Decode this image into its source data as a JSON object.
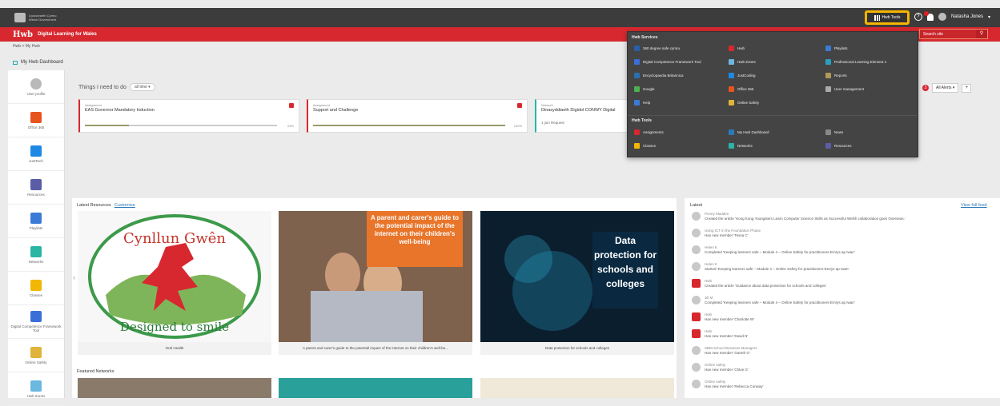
{
  "topbar": {
    "gov_logo_text": "Llywodraeth Cymru Welsh Government",
    "tools_label": "Hwb Tools",
    "help_label": "?",
    "user_name": "Natasha Jones"
  },
  "header": {
    "brand": "Hwb",
    "subtitle": "Digital Learning for Wales",
    "search_placeholder": "Search site",
    "accent": "#d7282f"
  },
  "breadcrumb": "Hwb > My Hwb",
  "dashboard_link": "My Hwb Dashboard",
  "sidebar": {
    "items": [
      {
        "label": "User profile",
        "icon": "user-icon",
        "color": "#b9b9b9"
      },
      {
        "label": "Office 365",
        "icon": "office-icon",
        "color": "#e8541e"
      },
      {
        "label": "JustTech",
        "icon": "just2easy-icon",
        "color": "#1e88e5"
      },
      {
        "label": "Resources",
        "icon": "resources-icon",
        "color": "#5b5ea6"
      },
      {
        "label": "Playlists",
        "icon": "playlists-icon",
        "color": "#3a7bd5"
      },
      {
        "label": "Networks",
        "icon": "networks-icon",
        "color": "#2ab5a5"
      },
      {
        "label": "Classes",
        "icon": "classes-icon",
        "color": "#f2b705"
      },
      {
        "label": "Digital Competence Framework Tool",
        "icon": "dcf-icon",
        "color": "#3a6fd8"
      },
      {
        "label": "Online Safety",
        "icon": "online-safety-icon",
        "color": "#e0b43a"
      },
      {
        "label": "Hwb Zones",
        "icon": "hwb-zones-icon",
        "color": "#6bb8e0"
      }
    ]
  },
  "todo": {
    "title": "Things I need to do",
    "filter": "all time",
    "cards": [
      {
        "type": "Assignment",
        "title": "EAS Governor Mandatory Induction",
        "pct_label": "23%",
        "progress": 0.23
      },
      {
        "type": "Assignment",
        "title": "Support and Challenge",
        "pct_label": "100%",
        "progress": 1.0
      },
      {
        "type": "Network",
        "title": "Dinasyddiaeth Digidol CONWY Digital",
        "sub": "1 join Request"
      }
    ]
  },
  "alerts": {
    "count": "3",
    "label": "All Alerts",
    "plus": "+"
  },
  "latest_resources": {
    "title": "Latest Resources",
    "customise": "Customise",
    "cards": [
      {
        "caption": "Oral Health",
        "image_text_top": "Cynllun Gwên",
        "image_text_bottom": "Designed to smile"
      },
      {
        "caption": "A parent and carer's guide to the potential impact of the internet on their children's well-be...",
        "image_text": "A parent and carer's guide to the potential impact of the internet on their children's well-being"
      },
      {
        "caption": "Data protection for schools and colleges",
        "image_text": "Data protection for schools and colleges"
      }
    ]
  },
  "featured_networks": {
    "title": "Featured Networks"
  },
  "latest_feed": {
    "title": "Latest",
    "view_full": "View full feed",
    "items": [
      {
        "who": "Penny Madden",
        "text": "Created the article 'Hong Kong Youngsters Learn Computer Science Skills as Successful Welsh collaboration goes Overseas.'"
      },
      {
        "who": "Using ICT in the Foundation Phase",
        "text": "Has new member 'Tessa C'"
      },
      {
        "who": "Helen K",
        "text": "Completed 'Keeping learners safe – Module 4 – Online Safety for practitioners-Emrys ap Iwan'"
      },
      {
        "who": "Helen K",
        "text": "Started 'Keeping learners safe – Module 4 – Online Safety for practitioners-Emrys ap Iwan'"
      },
      {
        "who": "Hwb",
        "text": "Created the article 'Guidance about data protection for schools and colleges'"
      },
      {
        "who": "Jill M",
        "text": "Completed 'Keeping learners safe – Module 4 – Online Safety for practitioners-Emrys ap Iwan'"
      },
      {
        "who": "Hwb",
        "text": "Has new member 'Charlotte W'"
      },
      {
        "who": "Hwb",
        "text": "Has new member 'David N'"
      },
      {
        "who": "SBM School Business Managers",
        "text": "Has new member 'Gareth G'"
      },
      {
        "who": "Online safety",
        "text": "Has new member 'Chloe G'"
      },
      {
        "who": "Online safety",
        "text": "Has new member 'Rebecca Conway'"
      }
    ]
  },
  "tools_menu": {
    "services_title": "Hwb Services",
    "services": [
      {
        "label": "360 degree safe cymru",
        "icon": "safe-icon",
        "color": "#2a5fa8"
      },
      {
        "label": "Hwb",
        "icon": "hwb-icon",
        "color": "#d7282f"
      },
      {
        "label": "Playlists",
        "icon": "playlists-icon",
        "color": "#3a7bd5"
      },
      {
        "label": "Digital Competence Framework Tool",
        "icon": "dcf-icon",
        "color": "#3a6fd8"
      },
      {
        "label": "Hwb Zones",
        "icon": "hwb-zones-icon",
        "color": "#6bb8e0"
      },
      {
        "label": "Professional Learning Element 4",
        "icon": "learning-icon",
        "color": "#2aa0c0"
      },
      {
        "label": "Encyclopaedia Britannica",
        "icon": "britannica-icon",
        "color": "#2a6fb0"
      },
      {
        "label": "JustCoding",
        "icon": "just2easy-icon",
        "color": "#1e88e5"
      },
      {
        "label": "Reports",
        "icon": "reports-icon",
        "color": "#b09a5a"
      },
      {
        "label": "Google",
        "icon": "google-icon",
        "color": "#4caf50"
      },
      {
        "label": "Office 365",
        "icon": "office-icon",
        "color": "#e8541e"
      },
      {
        "label": "User management",
        "icon": "user-management-icon",
        "color": "#aaa"
      },
      {
        "label": "Help",
        "icon": "help-icon",
        "color": "#3a7bd5"
      },
      {
        "label": "Online Safety",
        "icon": "online-safety-icon",
        "color": "#e0b43a"
      }
    ],
    "tools_title": "Hwb Tools",
    "tools": [
      {
        "label": "Assignments",
        "icon": "assignments-icon",
        "color": "#d7282f"
      },
      {
        "label": "My Hwb Dashboard",
        "icon": "dashboard-icon",
        "color": "#2a7ab8"
      },
      {
        "label": "News",
        "icon": "news-icon",
        "color": "#888"
      },
      {
        "label": "Classes",
        "icon": "classes-icon",
        "color": "#f2b705"
      },
      {
        "label": "Networks",
        "icon": "networks-icon",
        "color": "#2ab5a5"
      },
      {
        "label": "Resources",
        "icon": "resources-icon",
        "color": "#5b5ea6"
      }
    ]
  }
}
